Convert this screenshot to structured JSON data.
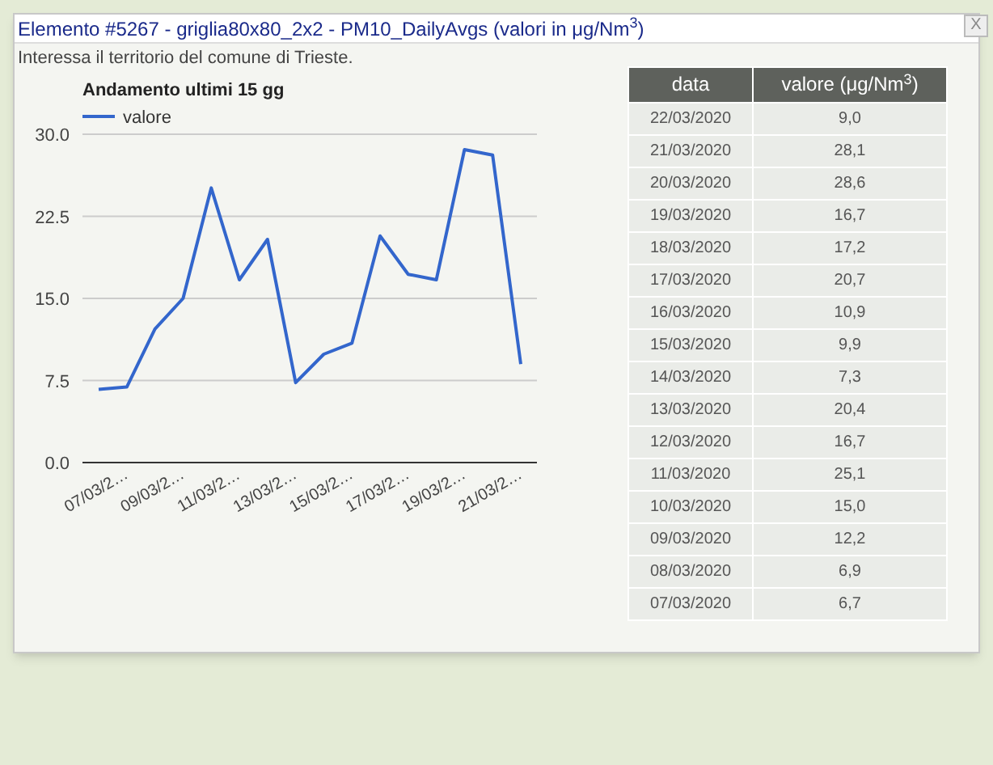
{
  "popup": {
    "title": "Elemento #5267 - griglia80x80_2x2 - PM10_DailyAvgs (valori in μg/Nm$^{3}$)",
    "close_label": "X",
    "description": "Interessa il territorio del comune di Trieste.",
    "chart_data": {
      "type": "line",
      "title": "Andamento ultimi 15 gg",
      "grid": true,
      "categories": [
        "07/03/2…",
        null,
        "09/03/2…",
        null,
        "11/03/2…",
        null,
        "13/03/2…",
        null,
        "15/03/2…",
        null,
        "17/03/2…",
        null,
        "19/03/2…",
        null,
        "21/03/2…",
        null
      ],
      "series": [
        {
          "name": "valore",
          "color": "#3366cc",
          "values": [
            6.7,
            6.9,
            12.2,
            15.0,
            25.1,
            16.7,
            20.4,
            7.3,
            9.9,
            10.9,
            20.7,
            17.2,
            16.7,
            28.6,
            28.1,
            9.0
          ]
        }
      ],
      "ylim": [
        0,
        30
      ],
      "yticks": [
        {
          "value": 0,
          "label": "0.0"
        },
        {
          "value": 7.5,
          "label": "7.5"
        },
        {
          "value": 15,
          "label": "15.0"
        },
        {
          "value": 22.5,
          "label": "22.5"
        },
        {
          "value": 30,
          "label": "30.0"
        }
      ]
    },
    "table": {
      "columns": [
        "data",
        "valore (μg/Nm$^{3}$)"
      ],
      "rows": [
        [
          "22/03/2020",
          "9,0"
        ],
        [
          "21/03/2020",
          "28,1"
        ],
        [
          "20/03/2020",
          "28,6"
        ],
        [
          "19/03/2020",
          "16,7"
        ],
        [
          "18/03/2020",
          "17,2"
        ],
        [
          "17/03/2020",
          "20,7"
        ],
        [
          "16/03/2020",
          "10,9"
        ],
        [
          "15/03/2020",
          "9,9"
        ],
        [
          "14/03/2020",
          "7,3"
        ],
        [
          "13/03/2020",
          "20,4"
        ],
        [
          "12/03/2020",
          "16,7"
        ],
        [
          "11/03/2020",
          "25,1"
        ],
        [
          "10/03/2020",
          "15,0"
        ],
        [
          "09/03/2020",
          "12,2"
        ],
        [
          "08/03/2020",
          "6,9"
        ],
        [
          "07/03/2020",
          "6,7"
        ]
      ]
    }
  }
}
